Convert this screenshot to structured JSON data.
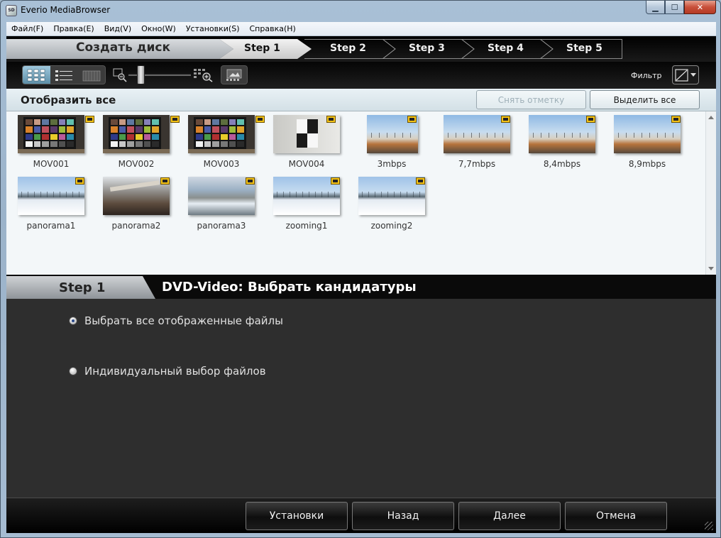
{
  "window": {
    "title": "Everio MediaBrowser",
    "icon_text": "SD"
  },
  "menu": [
    "Файл(F)",
    "Правка(E)",
    "Вид(V)",
    "Окно(W)",
    "Установки(S)",
    "Справка(H)"
  ],
  "stepbar": {
    "main": "Создать диск",
    "steps": [
      "Step 1",
      "Step 2",
      "Step 3",
      "Step 4",
      "Step 5"
    ],
    "active_step": 1
  },
  "toolbar": {
    "filter_label": "Фильтр",
    "zoom_level": 0.2,
    "active_view": "grid"
  },
  "selection": {
    "show_all": "Отобразить все",
    "unmark": "Снять отметку",
    "select_all": "Выделить все"
  },
  "thumbnails": [
    {
      "name": "MOV001",
      "kind": "chart"
    },
    {
      "name": "MOV002",
      "kind": "chart"
    },
    {
      "name": "MOV003",
      "kind": "chart"
    },
    {
      "name": "MOV004",
      "kind": "checker"
    },
    {
      "name": "3mbps",
      "kind": "street"
    },
    {
      "name": "7,7mbps",
      "kind": "street"
    },
    {
      "name": "8,4mbps",
      "kind": "street"
    },
    {
      "name": "8,9mbps",
      "kind": "street"
    },
    {
      "name": "panorama1",
      "kind": "snow"
    },
    {
      "name": "panorama2",
      "kind": "bridge"
    },
    {
      "name": "panorama3",
      "kind": "river"
    },
    {
      "name": "zooming1",
      "kind": "snow"
    },
    {
      "name": "zooming2",
      "kind": "snow"
    }
  ],
  "step_panel": {
    "step": "Step 1",
    "title": "DVD-Video: Выбрать кандидатуры",
    "options": [
      {
        "label": "Выбрать все отображенные файлы",
        "selected": true
      },
      {
        "label": "Индивидуальный выбор файлов",
        "selected": false
      }
    ]
  },
  "footer": {
    "settings": "Установки",
    "back": "Назад",
    "next": "Далее",
    "cancel": "Отмена"
  },
  "colors": {
    "film_badge": "#f4c318",
    "active_view": "#7fb0c8",
    "panel_bg": "#2e2e2e"
  }
}
